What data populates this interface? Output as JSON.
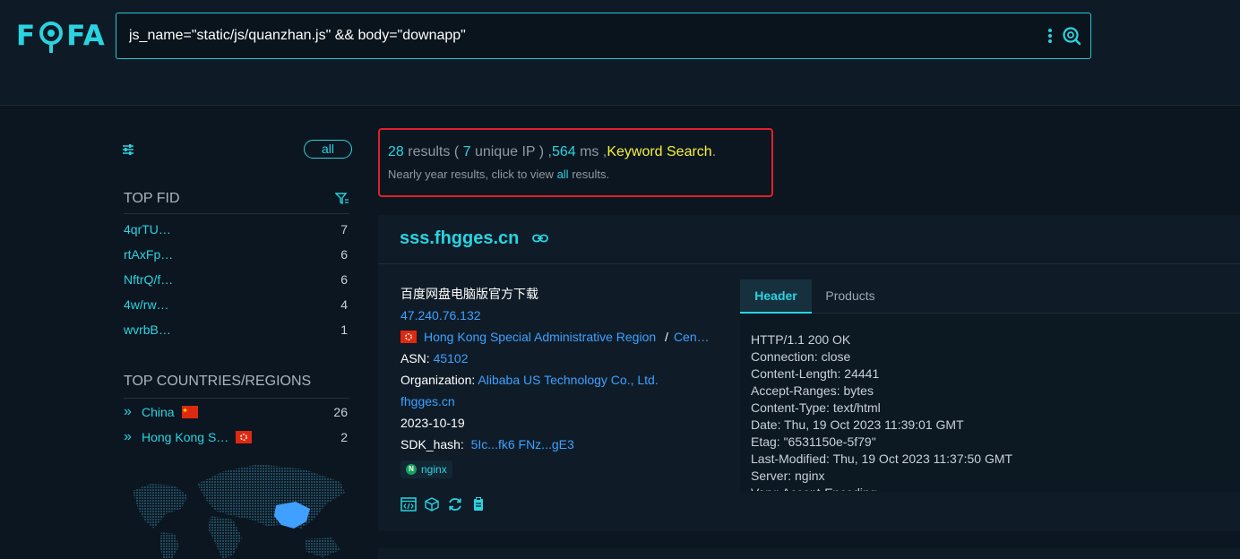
{
  "app": {
    "logo_text": "FOFA"
  },
  "search": {
    "query": "js_name=\"static/js/quanzhan.js\" && body=\"downapp\""
  },
  "sidebar": {
    "all_pill": "all",
    "top_fid": {
      "title": "TOP FID",
      "items": [
        {
          "label": "4qrTU…",
          "count": "7"
        },
        {
          "label": "rtAxFp…",
          "count": "6"
        },
        {
          "label": "NftrQ/f…",
          "count": "6"
        },
        {
          "label": "4w/rw…",
          "count": "4"
        },
        {
          "label": "wvrbB…",
          "count": "1"
        }
      ]
    },
    "top_countries": {
      "title": "TOP COUNTRIES/REGIONS",
      "items": [
        {
          "label": "China",
          "count": "26"
        },
        {
          "label": "Hong Kong S…",
          "count": "2"
        }
      ]
    }
  },
  "summary": {
    "results": "28",
    "results_word": " results (",
    "unique": "7",
    "unique_word": " unique IP ) ,",
    "ms": "564",
    "ms_word": " ms ,",
    "keyword": "Keyword Search",
    "period": ".",
    "line2_prefix": "Nearly year results, click to view ",
    "line2_link": "all",
    "line2_suffix": " results."
  },
  "result": {
    "host": "sss.fhgges.cn",
    "title": "百度网盘电脑版官方下载",
    "ip": "47.240.76.132",
    "region": "Hong Kong Special Administrative Region",
    "region_sep": "/",
    "city": "Cen…",
    "asn_label": "ASN:",
    "asn": "45102",
    "org_label": "Organization:",
    "org": "Alibaba US Technology Co., Ltd.",
    "domain": "fhgges.cn",
    "date": "2023-10-19",
    "sdk_label": "SDK_hash:",
    "sdk": "5Ic...fk6 FNz...gE3",
    "tag": "nginx",
    "tabs": {
      "header": "Header",
      "products": "Products"
    },
    "header_lines": [
      "HTTP/1.1 200 OK",
      "Connection: close",
      "Content-Length: 24441",
      "Accept-Ranges: bytes",
      "Content-Type: text/html",
      "Date: Thu, 19 Oct 2023 11:39:01 GMT",
      "Etag: \"6531150e-5f79\"",
      "Last-Modified: Thu, 19 Oct 2023 11:37:50 GMT",
      "Server: nginx",
      "Vary: Accept-Encoding"
    ]
  },
  "colors": {
    "accent": "#29d4e1",
    "link": "#3fa0ff",
    "keyword": "#f5f03a",
    "highlight_border": "#e0202a"
  }
}
